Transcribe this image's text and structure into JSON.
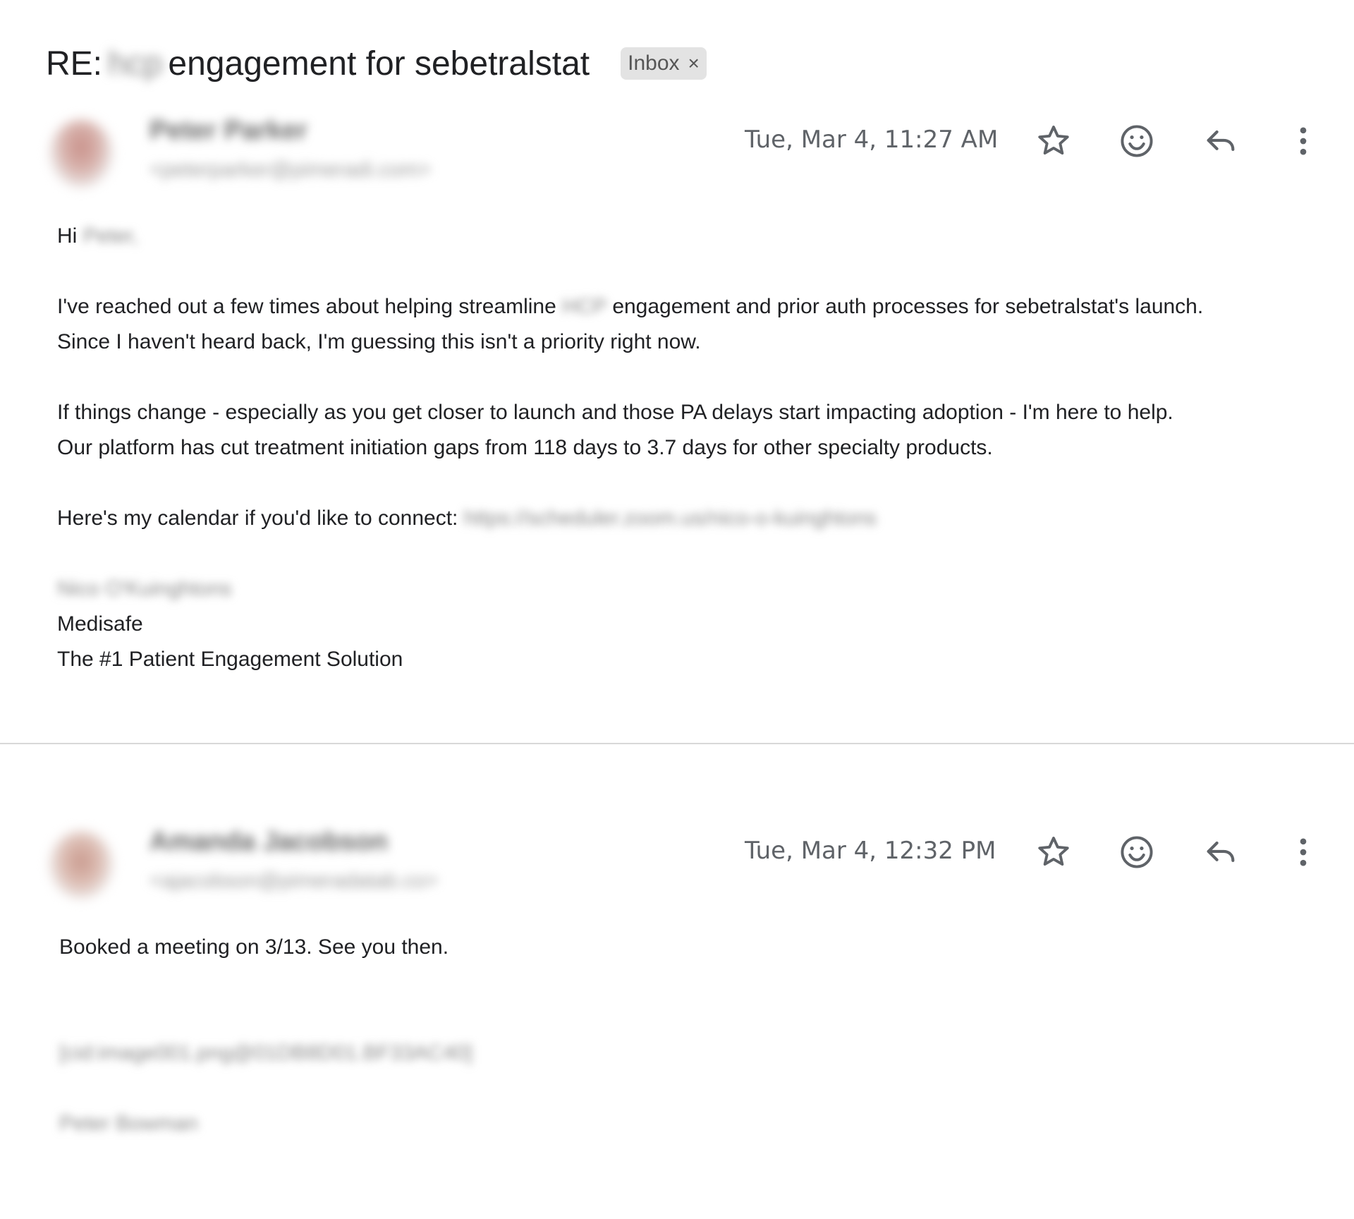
{
  "thread": {
    "subject_prefix": "RE:",
    "subject_redacted": "hcp",
    "subject_suffix": "engagement for sebetralstat",
    "label": "Inbox",
    "label_remove": "×"
  },
  "messages": [
    {
      "sender_name": "Peter Parker",
      "sender_email": "<peterparker@pimeradi.com>",
      "timestamp": "Tue, Mar 4, 11:27 AM",
      "greeting": "Hi",
      "greeting_name": "Peter,",
      "p1_a": "I've reached out a few times about helping streamline",
      "p1_redacted": "HCP",
      "p1_b": "engagement and prior auth processes for sebetralstat's launch.",
      "p1_c": "Since I haven't heard back, I'm guessing this isn't a priority right now.",
      "p2_a": "If things change - especially as you get closer to launch and those PA delays start impacting adoption - I'm here to help.",
      "p2_b": "Our platform has cut treatment initiation gaps from 118 days to 3.7 days for other specialty products.",
      "p3": "Here's my calendar if you'd like to connect:",
      "p3_link": "https://scheduler.zoom.us/nico-o-kuinghtons",
      "sig_name": "Nico O'Kuinghtons",
      "sig_company": "Medisafe",
      "sig_tagline": "The #1 Patient Engagement Solution"
    },
    {
      "sender_name": "Amanda Jacobson",
      "sender_email": "<ajacobson@pimeradatab.co>",
      "timestamp": "Tue, Mar 4, 12:32 PM",
      "body_line": "Booked a meeting on 3/13. See you then.",
      "image_ref": "[cid:image001.png@01DB8D01.BF33AC40]",
      "sig_name": "Peter Bowman"
    }
  ],
  "icons": {
    "star": "star-icon",
    "emoji": "emoji-icon",
    "reply": "reply-icon",
    "more": "more-vert-icon"
  },
  "colors": {
    "text": "#202124",
    "muted": "#5f6368",
    "chip_bg": "#e3e3e3",
    "divider": "#d8d8d8"
  }
}
